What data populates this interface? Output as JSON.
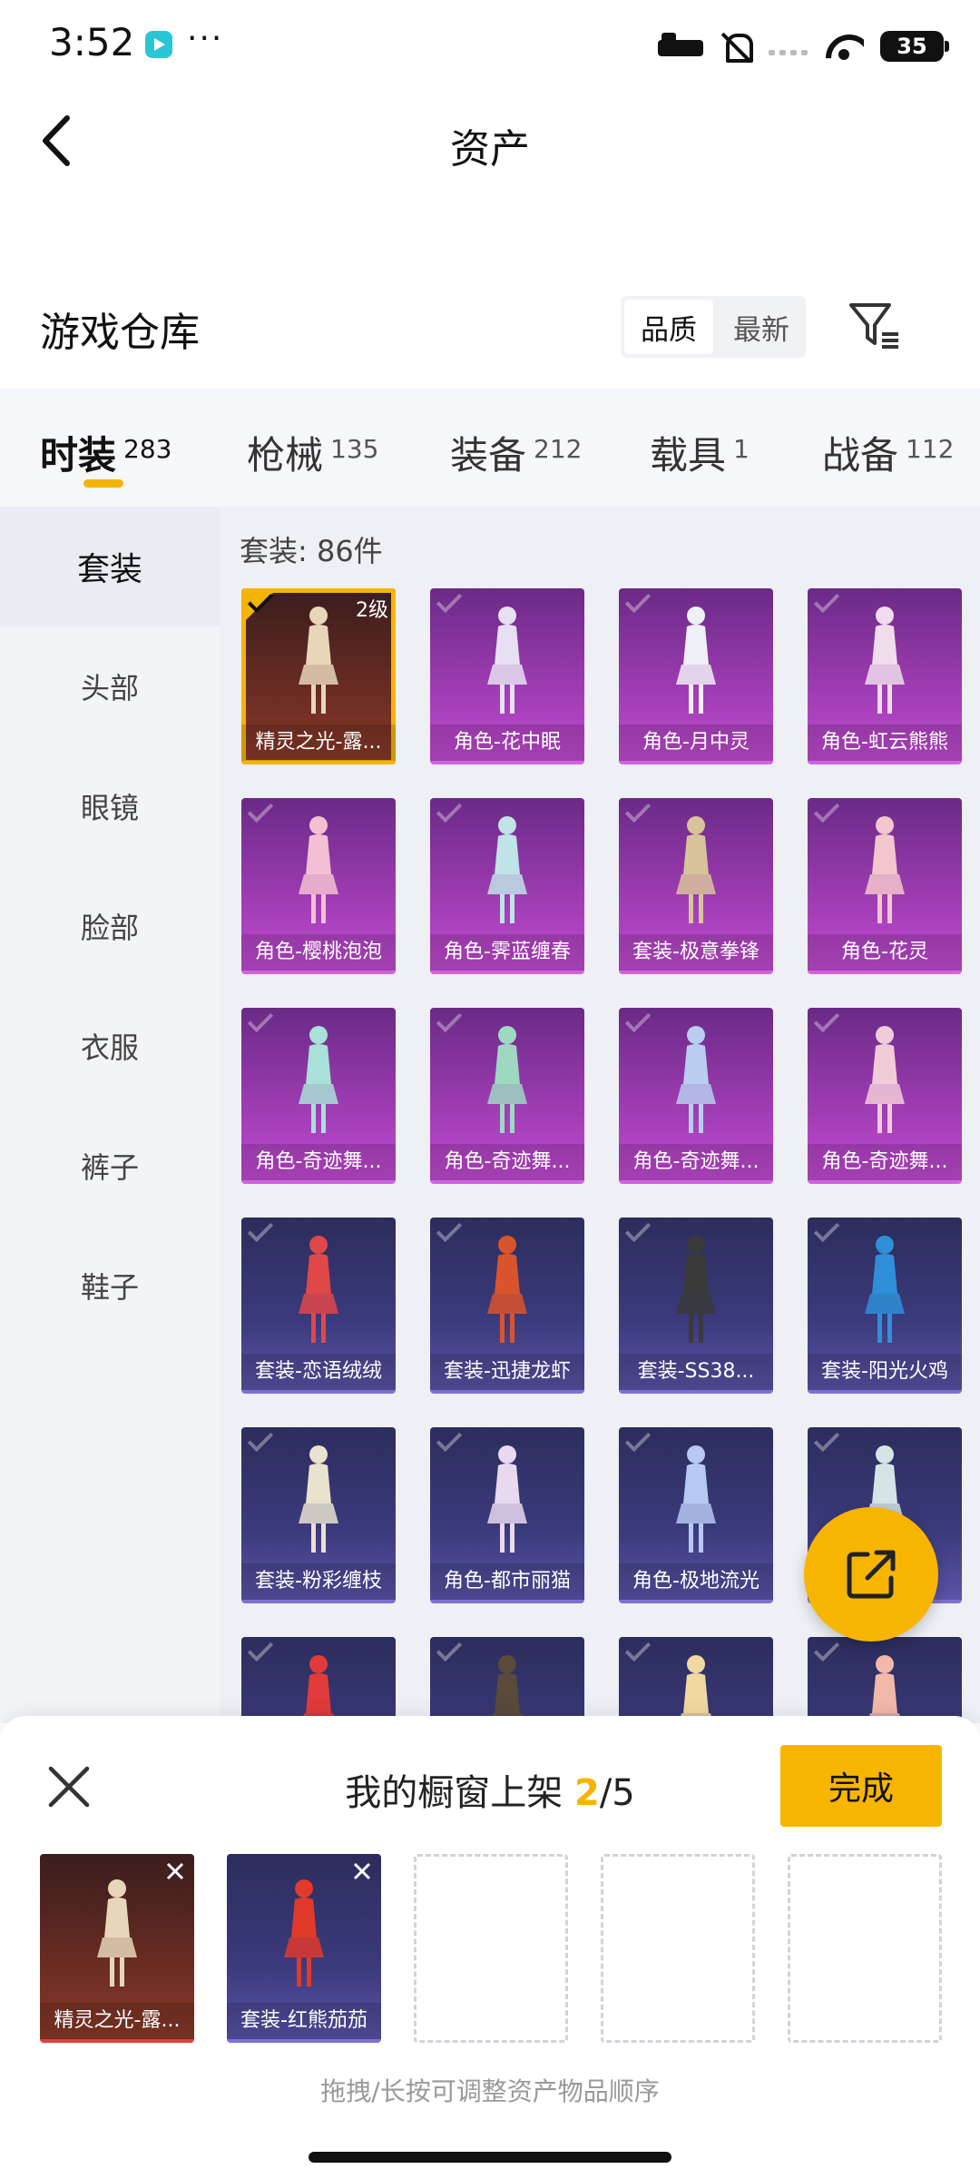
{
  "status_bar": {
    "time": "3:52",
    "dots": "···",
    "battery": "35"
  },
  "header": {
    "title": "资产"
  },
  "warehouse": {
    "title": "游戏仓库",
    "sort_options": [
      {
        "label": "品质",
        "active": true
      },
      {
        "label": "最新",
        "active": false
      }
    ]
  },
  "tabs": [
    {
      "label": "时装",
      "count": "283",
      "active": true
    },
    {
      "label": "枪械",
      "count": "135",
      "active": false
    },
    {
      "label": "装备",
      "count": "212",
      "active": false
    },
    {
      "label": "载具",
      "count": "1",
      "active": false
    },
    {
      "label": "战备",
      "count": "112",
      "active": false
    }
  ],
  "side_nav": [
    {
      "label": "套装",
      "active": true
    },
    {
      "label": "头部",
      "active": false
    },
    {
      "label": "眼镜",
      "active": false
    },
    {
      "label": "脸部",
      "active": false
    },
    {
      "label": "衣服",
      "active": false
    },
    {
      "label": "裤子",
      "active": false
    },
    {
      "label": "鞋子",
      "active": false
    }
  ],
  "grid": {
    "count_text": "套装: 86件",
    "items": [
      {
        "name": "精灵之光-露...",
        "theme": "red",
        "selected": true,
        "level": "2级",
        "figure": "#e8d6b8"
      },
      {
        "name": "角色-花中眠",
        "theme": "purple",
        "selected": false,
        "level": "",
        "figure": "#e6e0f2"
      },
      {
        "name": "角色-月中灵",
        "theme": "purple",
        "selected": false,
        "level": "",
        "figure": "#eef0f6"
      },
      {
        "name": "角色-虹云熊熊",
        "theme": "purple",
        "selected": false,
        "level": "",
        "figure": "#f0dceb"
      },
      {
        "name": "角色-樱桃泡泡",
        "theme": "purple",
        "selected": false,
        "level": "",
        "figure": "#f4bfd3"
      },
      {
        "name": "角色-霁蓝缠春",
        "theme": "purple",
        "selected": false,
        "level": "",
        "figure": "#bfe3e6"
      },
      {
        "name": "套装-极意拳锋",
        "theme": "purple",
        "selected": false,
        "level": "",
        "figure": "#d8c39a"
      },
      {
        "name": "角色-花灵",
        "theme": "purple",
        "selected": false,
        "level": "",
        "figure": "#f2c6cc"
      },
      {
        "name": "角色-奇迹舞...",
        "theme": "purple",
        "selected": false,
        "level": "",
        "figure": "#a9e0d8"
      },
      {
        "name": "角色-奇迹舞...",
        "theme": "purple",
        "selected": false,
        "level": "",
        "figure": "#9fd8c2"
      },
      {
        "name": "角色-奇迹舞...",
        "theme": "purple",
        "selected": false,
        "level": "",
        "figure": "#b8cdf0"
      },
      {
        "name": "角色-奇迹舞...",
        "theme": "purple",
        "selected": false,
        "level": "",
        "figure": "#f2cbd8"
      },
      {
        "name": "套装-恋语绒绒",
        "theme": "blue",
        "selected": false,
        "level": "",
        "figure": "#e04848"
      },
      {
        "name": "套装-迅捷龙虾",
        "theme": "blue",
        "selected": false,
        "level": "",
        "figure": "#d9542c"
      },
      {
        "name": "套装-SS38...",
        "theme": "blue",
        "selected": false,
        "level": "",
        "figure": "#3a3a3a"
      },
      {
        "name": "套装-阳光火鸡",
        "theme": "blue",
        "selected": false,
        "level": "",
        "figure": "#2f8fd8"
      },
      {
        "name": "套装-粉彩缠枝",
        "theme": "blue",
        "selected": false,
        "level": "",
        "figure": "#e8e2cf"
      },
      {
        "name": "角色-都市丽猫",
        "theme": "blue",
        "selected": false,
        "level": "",
        "figure": "#e8d8f0"
      },
      {
        "name": "角色-极地流光",
        "theme": "blue",
        "selected": false,
        "level": "",
        "figure": "#b7c8f2"
      },
      {
        "name": "",
        "theme": "blue",
        "selected": false,
        "level": "",
        "figure": "#d6e4e8"
      },
      {
        "name": "",
        "theme": "blue",
        "selected": false,
        "level": "",
        "figure": "#e03a3a"
      },
      {
        "name": "",
        "theme": "blue",
        "selected": false,
        "level": "",
        "figure": "#5a4a3a"
      },
      {
        "name": "",
        "theme": "blue",
        "selected": false,
        "level": "",
        "figure": "#f0d9a0"
      },
      {
        "name": "",
        "theme": "blue",
        "selected": false,
        "level": "",
        "figure": "#f2b8a8"
      }
    ]
  },
  "showcase": {
    "title_prefix": "我的橱窗上架 ",
    "current": "2",
    "total": "/5",
    "done_label": "完成",
    "slots": [
      {
        "name": "精灵之光-露...",
        "theme": "red",
        "filled": true,
        "figure": "#e8d6b8"
      },
      {
        "name": "套装-红熊茄茄",
        "theme": "blue",
        "filled": true,
        "figure": "#e03a2a"
      },
      {
        "name": "",
        "filled": false
      },
      {
        "name": "",
        "filled": false
      },
      {
        "name": "",
        "filled": false
      }
    ],
    "hint": "拖拽/长按可调整资产物品顺序"
  },
  "colors": {
    "accent": "#f5b400",
    "purple_card": "#9b3bb0",
    "blue_card": "#3b3a7c"
  }
}
